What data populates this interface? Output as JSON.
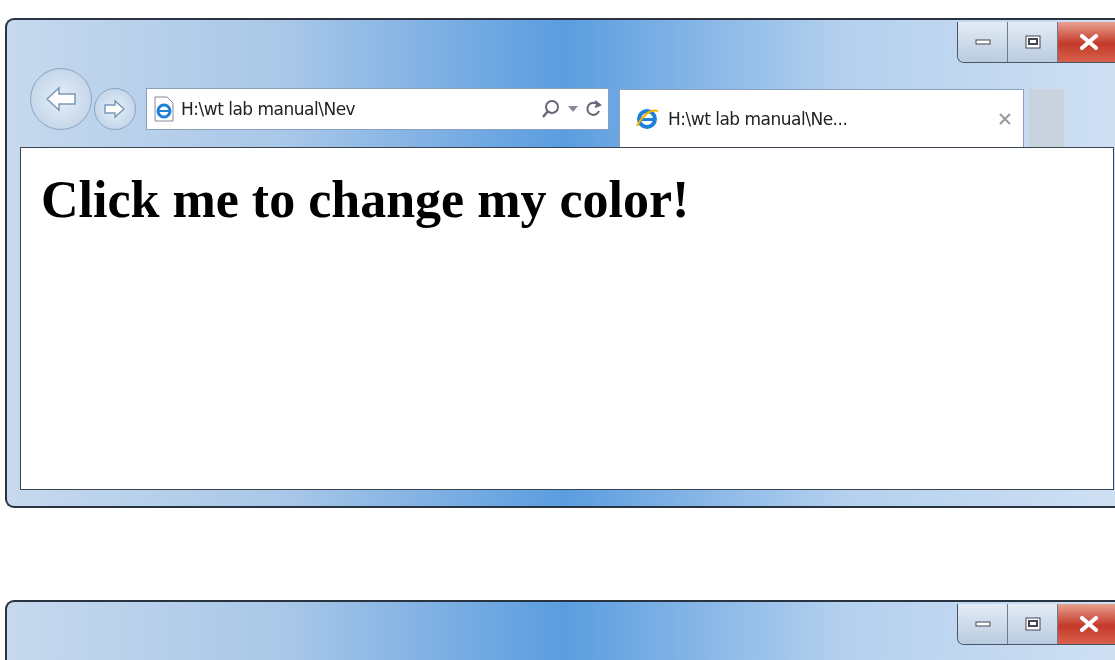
{
  "windows": [
    {
      "kind": "full",
      "address": "H:\\wt lab manual\\Nev",
      "tabs": [
        {
          "label": "H:\\wt lab manual\\Ne...",
          "selected": true
        }
      ],
      "heading": "Click me to change my color!"
    },
    {
      "kind": "titlebar"
    }
  ]
}
